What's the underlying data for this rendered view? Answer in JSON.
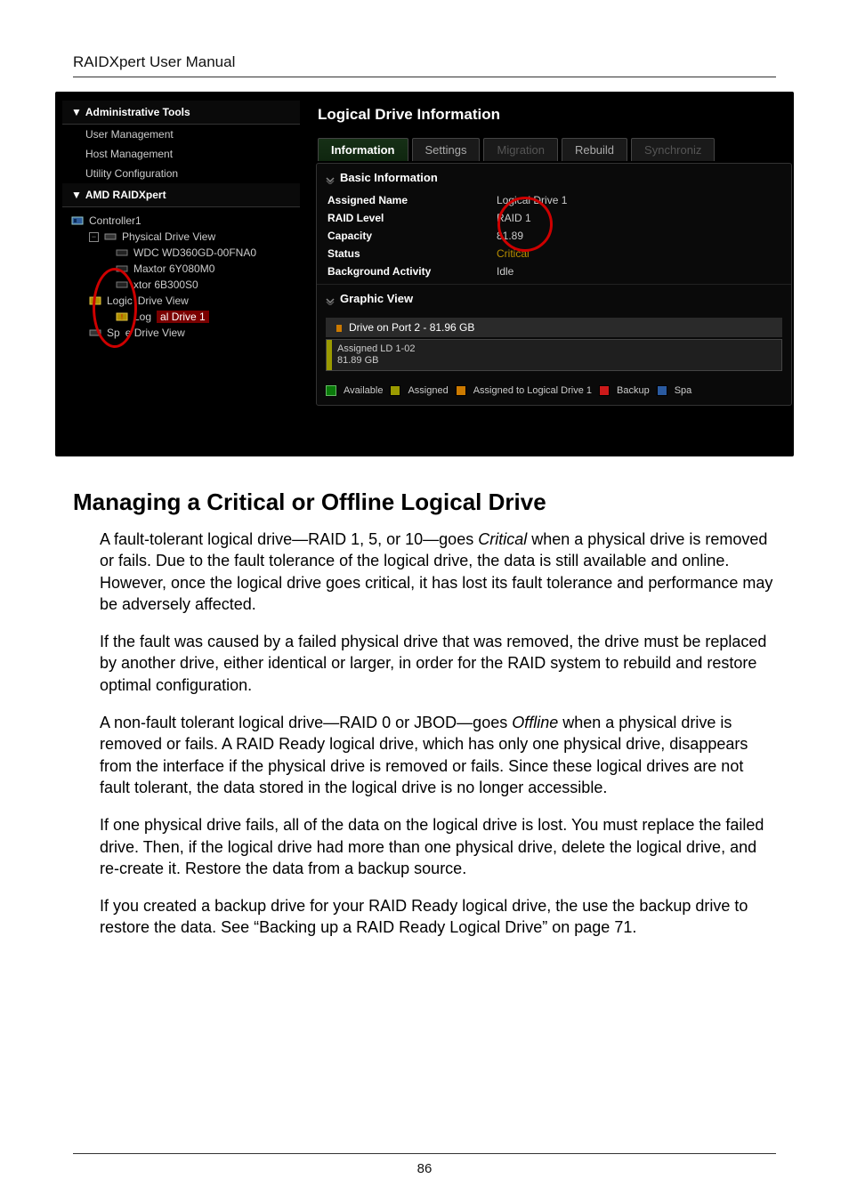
{
  "doc": {
    "header": "RAIDXpert User Manual",
    "page_number": "86",
    "h2": "Managing a Critical or Offline Logical Drive",
    "p1_a": "A fault-tolerant logical drive—RAID 1, 5, or 10—goes ",
    "p1_critical": "Critical",
    "p1_b": " when a physical drive is removed or fails. Due to the fault tolerance of the logical drive, the data is still available and online. However, once the logical drive goes critical, it has lost its fault tolerance and performance may be adversely affected.",
    "p2": "If the fault was caused by a failed physical drive that was removed, the drive must be replaced by another drive, either identical or larger, in order for the RAID system to rebuild and restore optimal configuration.",
    "p3_a": "A non-fault tolerant logical drive—RAID 0 or JBOD—goes ",
    "p3_offline": "Offline",
    "p3_b": " when a physical drive is removed or fails. A RAID Ready logical drive, which has only one physical drive, disappears from the interface if the physical drive is removed or fails. Since these logical drives are not fault tolerant, the data stored in the logical drive is no longer accessible.",
    "p4": "If one physical drive fails, all of the data on the logical drive is lost. You must replace the failed drive. Then, if the logical drive had more than one physical drive, delete the logical drive, and re-create it. Restore the data from a backup source.",
    "p5": "If you created a backup drive for your RAID Ready logical drive, the use the backup drive to restore the data. See “Backing up a RAID Ready Logical Drive” on page 71."
  },
  "ui": {
    "left": {
      "admin_tools": "Administrative Tools",
      "items": [
        "User Management",
        "Host Management",
        "Utility Configuration"
      ],
      "raidxpert": "AMD RAIDXpert",
      "tree": {
        "controller": "Controller1",
        "pdv": "Physical Drive View",
        "d1": "WDC WD360GD-00FNA0",
        "d2": "Maxtor 6Y080M0",
        "d3_a": "xtor 6B300S0",
        "ldv_a": "Logic",
        "ldv_b": "Drive View",
        "ld1_a": "Log",
        "ld1_b": "al Drive 1",
        "sdv_a": "Sp",
        "sdv_b": "e Drive View"
      }
    },
    "right": {
      "title": "Logical Drive Information",
      "tabs": [
        "Information",
        "Settings",
        "Migration",
        "Rebuild",
        "Synchroniz"
      ],
      "basic_info": "Basic Information",
      "rows": [
        {
          "k": "Assigned Name",
          "v": "Logical Drive 1"
        },
        {
          "k": "RAID Level",
          "v": "RAID 1"
        },
        {
          "k": "Capacity",
          "v": "81.89"
        },
        {
          "k": "Status",
          "v": "Critical"
        },
        {
          "k": "Background Activity",
          "v": "Idle"
        }
      ],
      "graphic_view": "Graphic View",
      "drive_label": "Drive on Port 2 - 81.96 GB",
      "assigned_l1": "Assigned LD 1-02",
      "assigned_l2": "81.89 GB",
      "legend": [
        "Available",
        "Assigned",
        "Assigned to Logical Drive 1",
        "Backup",
        "Spa"
      ]
    }
  }
}
